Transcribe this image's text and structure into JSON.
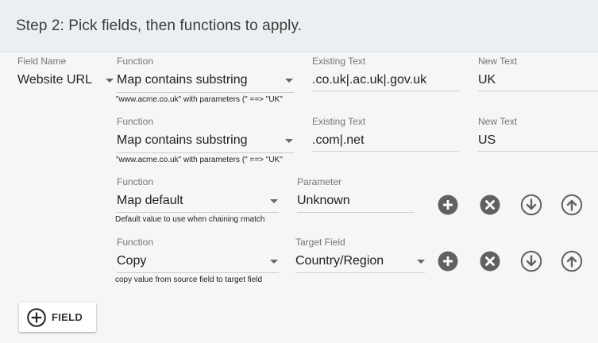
{
  "header": {
    "title": "Step 2: Pick fields, then functions to apply."
  },
  "labels": {
    "field_name": "Field Name",
    "function": "Function",
    "existing_text": "Existing Text",
    "new_text": "New Text",
    "parameter": "Parameter",
    "target_field": "Target Field"
  },
  "field": {
    "name": "Website URL"
  },
  "rows": [
    {
      "function": "Map contains substring",
      "hint": "\"www.acme.co.uk\" with parameters (\" ==> \"UK\"",
      "existing_text": ".co.uk|.ac.uk|.gov.uk",
      "new_text": "UK"
    },
    {
      "function": "Map contains substring",
      "hint": "\"www.acme.co.uk\" with parameters (\" ==> \"UK\"",
      "existing_text": ".com|.net",
      "new_text": "US"
    },
    {
      "function": "Map default",
      "hint": "Default value to use when chaining rmatch",
      "parameter": "Unknown"
    },
    {
      "function": "Copy",
      "hint": "copy value from source field to target field",
      "target_field": "Country/Region"
    }
  ],
  "actions": {
    "add_icon": "plus-circle-icon",
    "remove_icon": "x-circle-icon",
    "move_down_icon": "arrow-down-circle-icon",
    "move_up_icon": "arrow-up-circle-icon"
  },
  "add_field_button": {
    "label": "FIELD",
    "icon": "plus-circle-outline-icon"
  },
  "colors": {
    "header_bg": "#eceff1",
    "page_bg": "#f6f6f6",
    "icon_dark": "#616161"
  }
}
